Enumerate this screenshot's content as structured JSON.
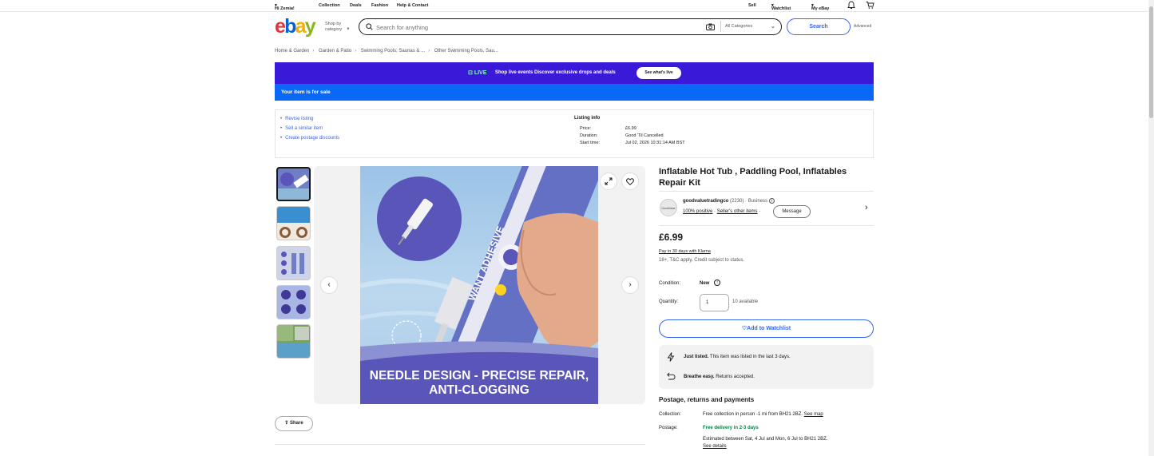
{
  "topnav": {
    "greeting": "Hi Zemia!",
    "links": [
      "Collection",
      "Deals",
      "Fashion",
      "Help & Contact"
    ],
    "right": [
      "Sell",
      "Watchlist",
      "My eBay"
    ]
  },
  "header": {
    "shop_by": "Shop by category",
    "search_placeholder": "Search for anything",
    "category": "All Categories",
    "search_button": "Search",
    "advanced": "Advanced"
  },
  "breadcrumb": [
    "Home & Garden",
    "Garden & Patio",
    "Swimming Pools, Saunas & ...",
    "Other Swimming Pools, Sau..."
  ],
  "live_banner": {
    "live": "LIVE",
    "text": "Shop live events  Discover exclusive drops and deals",
    "button": "See what's live"
  },
  "sale_bar": "Your item is for sale",
  "seller_actions": [
    "Revise listing",
    "Sell a similar item",
    "Create postage discounts"
  ],
  "listing_info": {
    "heading": "Listing info",
    "rows": [
      {
        "k": "Price:",
        "v": "£6.99"
      },
      {
        "k": "Duration:",
        "v": "Good 'Til Cancelled"
      },
      {
        "k": "Start time:",
        "v": "Jul 02, 2026 10:31:14 AM BST"
      }
    ]
  },
  "image": {
    "caption_line1": "NEEDLE DESIGN - PRECISE REPAIR,",
    "caption_line2": "ANTI-CLOGGING",
    "tube_text": "WANT ADHESIVE"
  },
  "share": "Share",
  "item": {
    "title": "Inflatable Hot Tub , Paddling Pool, Inflatables Repair Kit",
    "seller_name": "goodvaluetradingco",
    "seller_score": "(2230)",
    "seller_type": "· Business",
    "positive": "100% positive",
    "other_items": "Seller's other items",
    "message": "Message",
    "logo_text": "GoodValue",
    "price": "£6.99",
    "klarna": "Pay in 30 days with Klarna",
    "klarna_note": "18+, T&C apply, Credit subject to status.",
    "condition_label": "Condition:",
    "condition": "New",
    "quantity_label": "Quantity:",
    "quantity": "1",
    "available": "10 available",
    "watchlist": "Add to Watchlist",
    "note1_bold": "Just listed.",
    "note1": " This item was listed in the last 3 days.",
    "note2_bold": "Breathe easy.",
    "note2": " Returns accepted.",
    "postage_heading": "Postage, returns and payments",
    "collection_label": "Collection:",
    "collection": "Free collection in person -1 mi from BH21 2BZ.",
    "see_map": "See map",
    "postage_label": "Postage:",
    "postage": "Free delivery in 2-3 days",
    "estimated": "Estimated between Sat, 4 Jul and Mon, 6 Jul to BH21 2BZ.",
    "see_details": "See details"
  }
}
